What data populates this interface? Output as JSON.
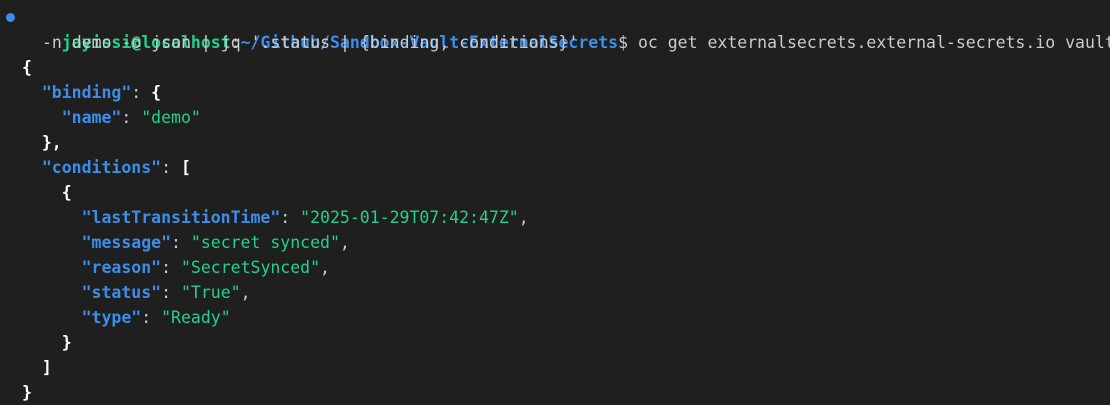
{
  "colors": {
    "background": "#1f1f1f",
    "foreground": "#cccccc",
    "prompt_user": "#23d18b",
    "prompt_path": "#3b8eea",
    "json_key": "#3b8eea",
    "json_string": "#23d18b",
    "status_dot": "#3b8eea"
  },
  "prompt": {
    "indicator_icon": "circle-status-icon",
    "user_host": "jayissi@localhost",
    "separator": ":",
    "path": "~/Github/Sandbox-Vault-ExternalSecrets",
    "symbol": "$",
    "command_line1": " oc get externalsecrets.external-secrets.io vault \\",
    "command_line2": "-n demo -o json | jq '.status | {binding, conditions}'"
  },
  "output": {
    "open_root": "{",
    "binding": {
      "key": "\"binding\"",
      "open": "{",
      "name_key": "\"name\"",
      "name_value": "\"demo\"",
      "close": "},"
    },
    "conditions": {
      "key": "\"conditions\"",
      "open": "[",
      "item_open": "{",
      "fields": [
        {
          "key": "\"lastTransitionTime\"",
          "value": "\"2025-01-29T07:42:47Z\"",
          "trail": ","
        },
        {
          "key": "\"message\"",
          "value": "\"secret synced\"",
          "trail": ","
        },
        {
          "key": "\"reason\"",
          "value": "\"SecretSynced\"",
          "trail": ","
        },
        {
          "key": "\"status\"",
          "value": "\"True\"",
          "trail": ","
        },
        {
          "key": "\"type\"",
          "value": "\"Ready\"",
          "trail": ""
        }
      ],
      "item_close": "}",
      "close": "]"
    },
    "close_root": "}"
  }
}
